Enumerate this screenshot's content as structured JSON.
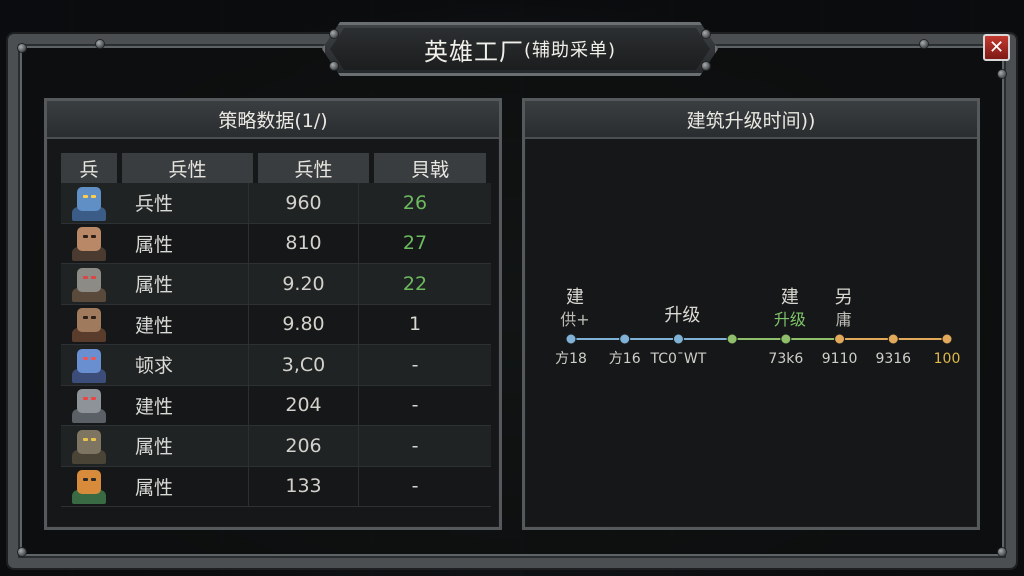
{
  "title": {
    "main": "英雄工厂",
    "sub": "(辅助采单)"
  },
  "close_label": "✕",
  "left_panel": {
    "header": "策略数据(1/)",
    "columns": [
      "兵",
      "兵性",
      "兵性",
      "貝戟"
    ],
    "rows": [
      {
        "avatar": "blue-robot-avatar",
        "name": "兵性",
        "value": "960",
        "bonus": "26",
        "green": true
      },
      {
        "avatar": "brown-haired-hero-avatar",
        "name": "属性",
        "value": "810",
        "bonus": "27",
        "green": true
      },
      {
        "avatar": "wolf-mask-avatar",
        "name": "属性",
        "value": "9.20",
        "bonus": "22",
        "green": true
      },
      {
        "avatar": "scarred-soldier-avatar",
        "name": "建性",
        "value": "9.80",
        "bonus": "1",
        "green": false
      },
      {
        "avatar": "blue-mech-avatar",
        "name": "顿求",
        "value": "3,C0",
        "bonus": "-",
        "green": false
      },
      {
        "avatar": "grey-robot-avatar",
        "name": "建性",
        "value": "204",
        "bonus": "-",
        "green": false
      },
      {
        "avatar": "goblin-avatar",
        "name": "属性",
        "value": "206",
        "bonus": "-",
        "green": false
      },
      {
        "avatar": "orange-mask-avatar",
        "name": "属性",
        "value": "133",
        "bonus": "-",
        "green": false
      }
    ]
  },
  "right_panel": {
    "header": "建筑升级时间))",
    "nodes": [
      {
        "top": "建",
        "top2": "供+",
        "label": "方18",
        "color": "#7fb2d6"
      },
      {
        "top": "",
        "top2": "",
        "label": "方16",
        "color": "#7fb2d6"
      },
      {
        "top": "升级",
        "top2": "",
        "label": "TC0ˉWT",
        "color": "#7fb2d6"
      },
      {
        "top": "",
        "top2": "",
        "label": "",
        "color": "#8fbf6a"
      },
      {
        "top": "建",
        "top2": "升级",
        "label": "73k6",
        "color": "#8fbf6a"
      },
      {
        "top": "另",
        "top2": "庸",
        "label": "9110",
        "color": "#e2a95a"
      },
      {
        "top": "",
        "top2": "",
        "label": "9316",
        "color": "#e2a95a"
      },
      {
        "top": "",
        "top2": "",
        "label": "100",
        "color": "#e2a95a"
      }
    ],
    "highlight_color": "#e0b84a"
  }
}
